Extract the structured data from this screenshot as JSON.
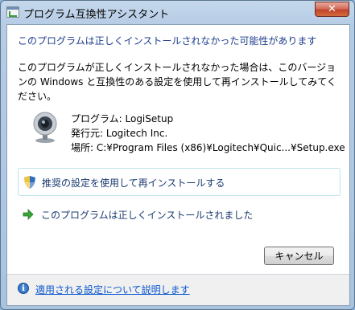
{
  "window": {
    "title": "プログラム互換性アシスタント",
    "close_label": "✕"
  },
  "content": {
    "heading": "このプログラムは正しくインストールされなかった可能性があります",
    "description": "このプログラムが正しくインストールされなかった場合は、このバージョンの Windows と互換性のある設定を使用して再インストールしてみてください。"
  },
  "program": {
    "name_row": "プログラム: LogiSetup",
    "publisher_row": "発行元: Logitech Inc.",
    "location_row": "場所: C:¥Program Files (x86)¥Logitech¥Quic...¥Setup.exe"
  },
  "options": {
    "recommended": "推奨の設定を使用して再インストールする",
    "installed_correctly": "このプログラムは正しくインストールされました"
  },
  "buttons": {
    "cancel": "キャンセル"
  },
  "footer": {
    "help_link": "適用される設定について説明します",
    "info_glyph": "i"
  },
  "colors": {
    "heading": "#1d3c8c",
    "link": "#0b57d0",
    "option_text": "#1a3a70"
  },
  "icons": {
    "title": "compatibility-icon",
    "program": "webcam-icon",
    "recommended": "shield-icon",
    "installed": "green-arrow-icon",
    "help": "info-icon"
  }
}
